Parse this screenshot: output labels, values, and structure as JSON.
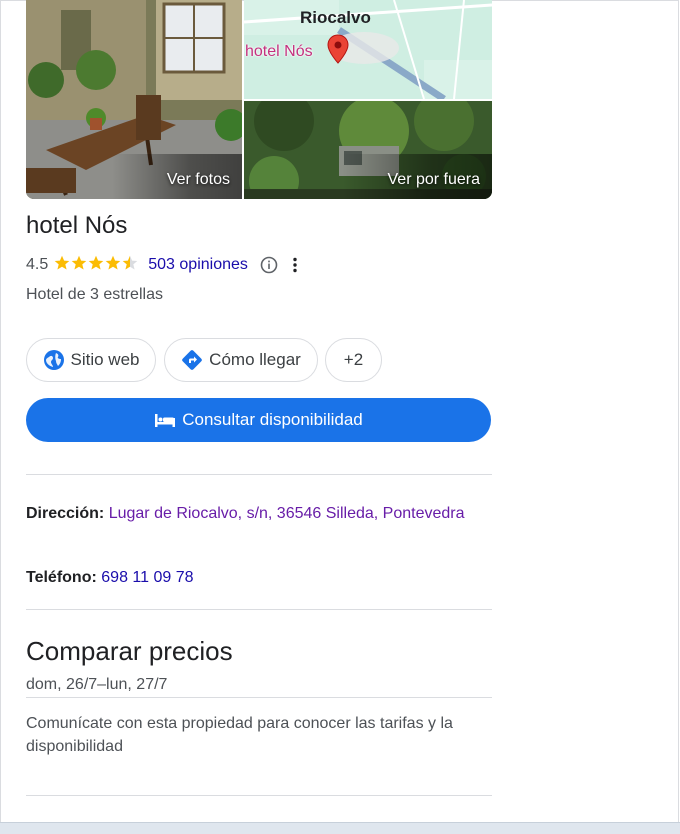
{
  "photos": {
    "main_label": "Ver fotos",
    "street_label": "Ver por fuera",
    "map_place": "Riocalvo",
    "map_pin_label": "hotel Nós"
  },
  "hotel": {
    "name": "hotel Nós",
    "rating": "4.5",
    "rating_value": 4.5,
    "reviews_label": "503 opiniones",
    "category": "Hotel de 3 estrellas"
  },
  "actions": {
    "website_label": "Sitio web",
    "directions_label": "Cómo llegar",
    "more_label": "+2",
    "availability_label": "Consultar disponibilidad"
  },
  "details": {
    "address_label": "Dirección:",
    "address_value": "Lugar de Riocalvo, s/n, 36546 Silleda, Pontevedra",
    "phone_label": "Teléfono:",
    "phone_value": "698 11 09 78"
  },
  "prices": {
    "title": "Comparar precios",
    "dates": "dom, 26/7–lun, 27/7",
    "note": "Comunícate con esta propiedad para conocer las tarifas y la disponibilidad"
  },
  "colors": {
    "accent": "#1a73e8",
    "link": "#1a0dab",
    "visited_link": "#681da8",
    "star": "#fbbc04",
    "map_pin": "#ea4335",
    "map_label": "#c5317f"
  },
  "icons": [
    "globe-icon",
    "directions-icon",
    "bed-icon",
    "info-icon",
    "more-vert-icon",
    "map-pin-icon",
    "star-icon"
  ]
}
